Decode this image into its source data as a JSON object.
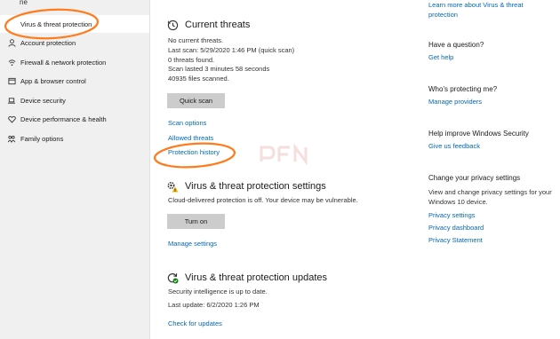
{
  "sidebar": {
    "home_partial": "ne",
    "items": [
      {
        "label": "Virus & threat protection",
        "icon": "shield-icon"
      },
      {
        "label": "Account protection",
        "icon": "person-icon"
      },
      {
        "label": "Firewall & network protection",
        "icon": "wifi-icon"
      },
      {
        "label": "App & browser control",
        "icon": "app-window-icon"
      },
      {
        "label": "Device security",
        "icon": "laptop-icon"
      },
      {
        "label": "Device performance & health",
        "icon": "heart-icon"
      },
      {
        "label": "Family options",
        "icon": "family-icon"
      }
    ]
  },
  "current_threats": {
    "title": "Current threats",
    "icon": "threat-history-icon",
    "status": "No current threats.",
    "last_scan": "Last scan: 5/29/2020 1:46 PM (quick scan)",
    "threats_found": "0 threats found.",
    "scan_duration": "Scan lasted 3 minutes 58 seconds",
    "files_scanned": "40935 files scanned.",
    "quick_scan_button": "Quick scan",
    "scan_options_link": "Scan options",
    "allowed_threats_link": "Allowed threats",
    "protection_history_link": "Protection history"
  },
  "settings": {
    "title": "Virus & threat protection settings",
    "icon": "settings-warning-icon",
    "description": "Cloud-delivered protection is off. Your device may be vulnerable.",
    "turn_on_button": "Turn on",
    "manage_settings_link": "Manage settings"
  },
  "updates": {
    "title": "Virus & threat protection updates",
    "icon": "update-icon",
    "status": "Security intelligence is up to date.",
    "last_update": "Last update: 6/2/2020 1:26 PM",
    "check_updates_link": "Check for updates"
  },
  "right": {
    "learn_more_link": "Learn more about Virus & threat protection",
    "question_heading": "Have a question?",
    "get_help_link": "Get help",
    "protecting_heading": "Who's protecting me?",
    "manage_providers_link": "Manage providers",
    "improve_heading": "Help improve Windows Security",
    "feedback_link": "Give us feedback",
    "privacy_heading": "Change your privacy settings",
    "privacy_text": "View and change privacy settings for your Windows 10 device.",
    "privacy_settings_link": "Privacy settings",
    "privacy_dashboard_link": "Privacy dashboard",
    "privacy_statement_link": "Privacy Statement"
  },
  "colors": {
    "accent_link": "#0067b8",
    "annotation": "#ff7b1c",
    "warning": "#f2b600",
    "ok_green": "#107c10"
  }
}
